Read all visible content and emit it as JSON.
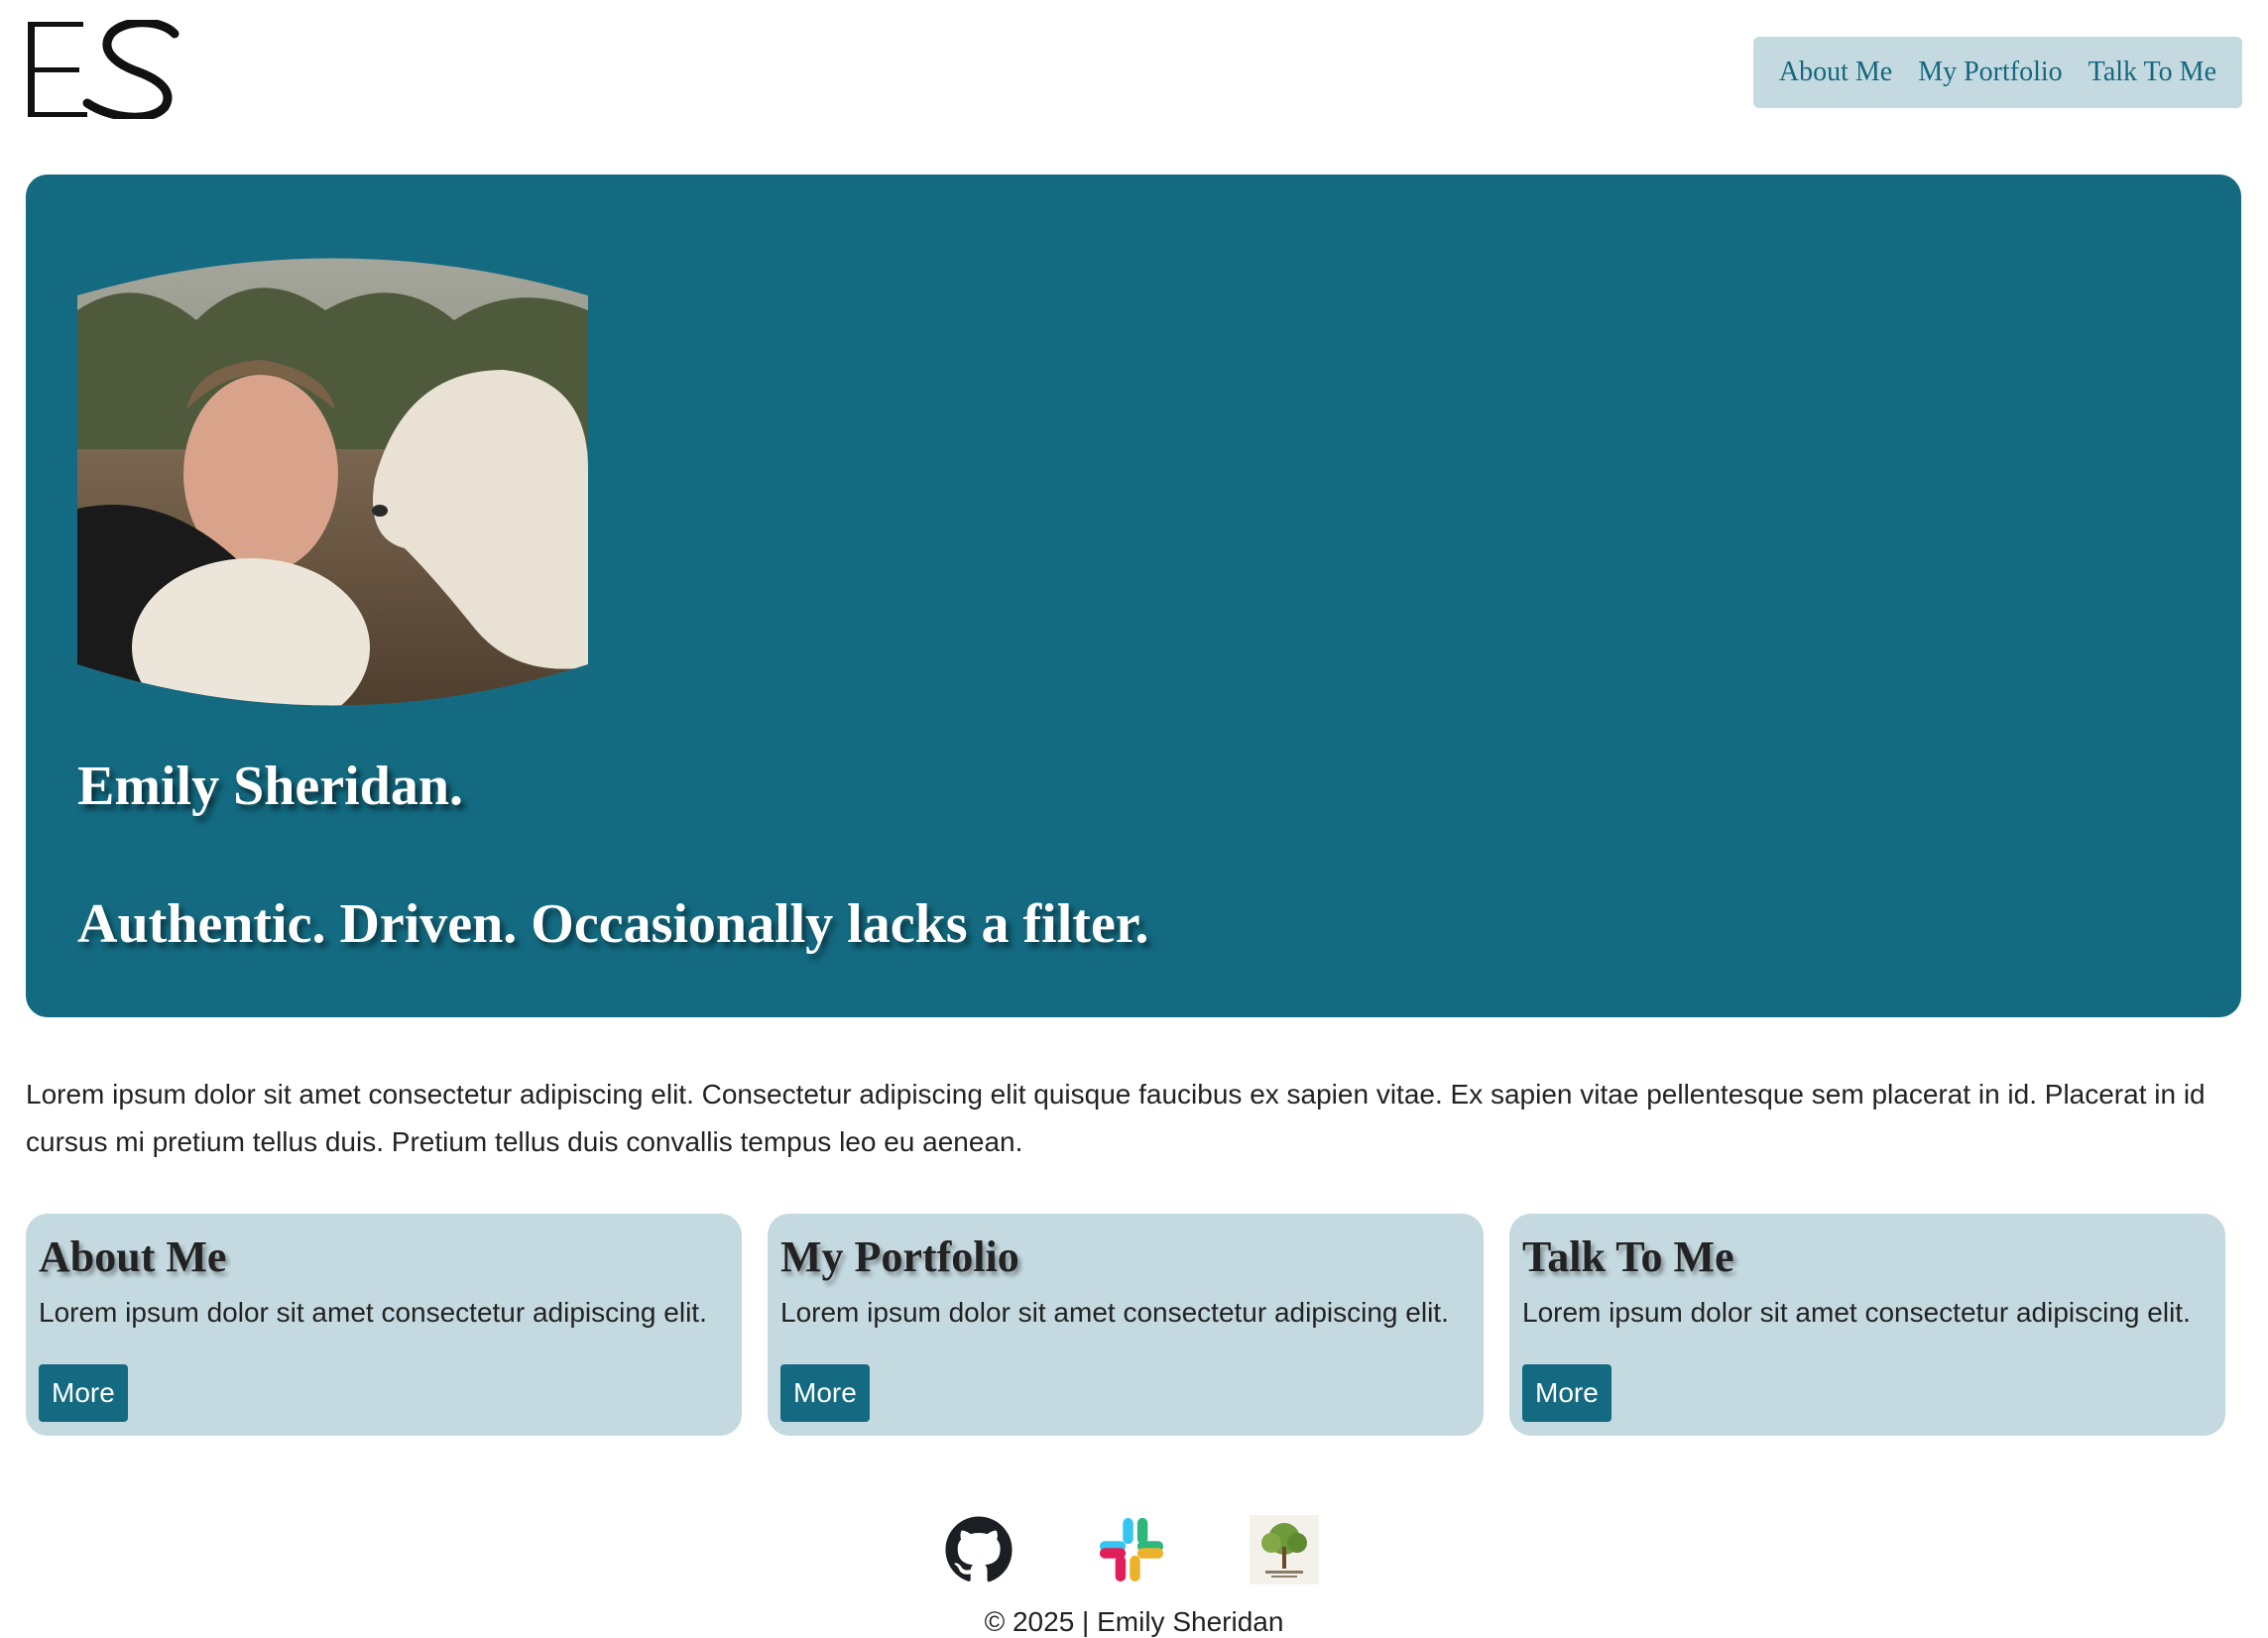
{
  "header": {
    "logo_text": "ES",
    "nav": [
      "About Me",
      "My Portfolio",
      "Talk To Me"
    ]
  },
  "hero": {
    "name": "Emily Sheridan.",
    "tagline": "Authentic. Driven. Occasionally lacks a filter."
  },
  "intro": "Lorem ipsum dolor sit amet consectetur adipiscing elit. Consectetur adipiscing elit quisque faucibus ex sapien vitae. Ex sapien vitae pellentesque sem placerat in id. Placerat in id cursus mi pretium tellus duis. Pretium tellus duis convallis tempus leo eu aenean.",
  "cards": [
    {
      "title": "About Me",
      "text": "Lorem ipsum dolor sit amet consectetur adipiscing elit.",
      "button": "More"
    },
    {
      "title": "My Portfolio",
      "text": "Lorem ipsum dolor sit amet consectetur adipiscing elit.",
      "button": "More"
    },
    {
      "title": "Talk To Me",
      "text": "Lorem ipsum dolor sit amet consectetur adipiscing elit.",
      "button": "More"
    }
  ],
  "footer": {
    "icons": [
      "github-icon",
      "slack-icon",
      "tree-logo-icon"
    ],
    "copyright": "© 2025 | Emily Sheridan"
  },
  "colors": {
    "accent": "#136a81",
    "card_bg": "#c4d9e0",
    "text": "#222222"
  }
}
